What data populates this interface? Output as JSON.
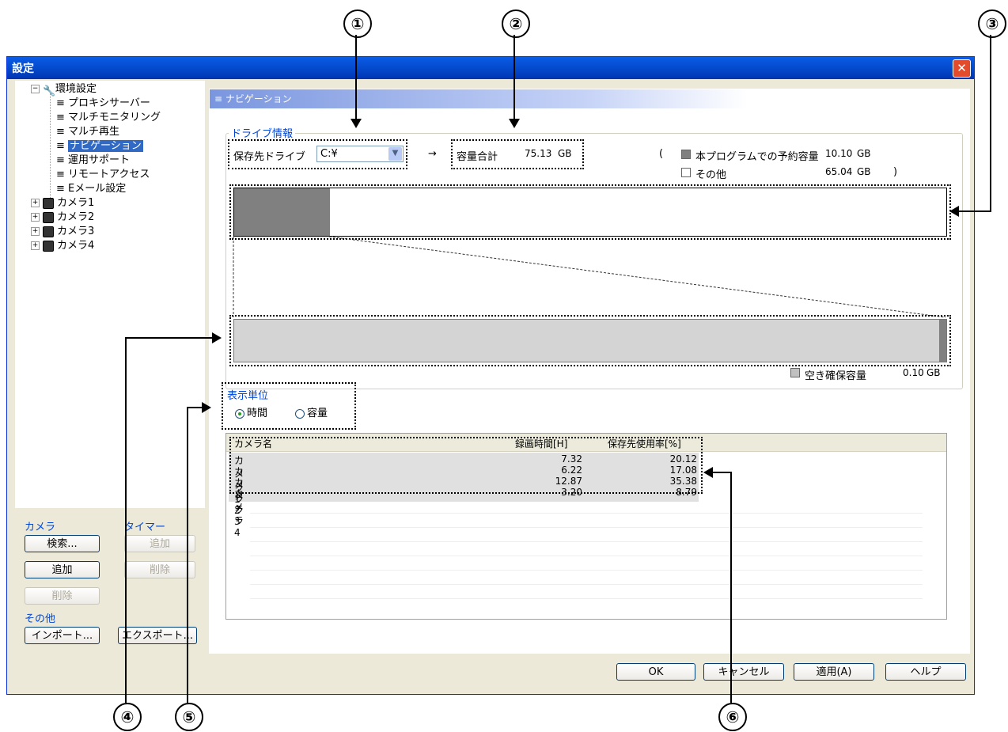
{
  "callouts": [
    "①",
    "②",
    "③",
    "④",
    "⑤",
    "⑥"
  ],
  "window": {
    "title": "設定",
    "close_glyph": "✕"
  },
  "tree": {
    "root": "環境設定",
    "children": [
      "プロキシサーバー",
      "マルチモニタリング",
      "マルチ再生",
      "ナビゲーション",
      "運用サポート",
      "リモートアクセス",
      "Eメール設定"
    ],
    "cameras": [
      "カメラ1",
      "カメラ2",
      "カメラ3",
      "カメラ4"
    ]
  },
  "left": {
    "camera_group": "カメラ",
    "timer_group": "タイマー",
    "search": "検索...",
    "add": "追加",
    "delete": "削除",
    "timer_add": "追加",
    "timer_delete": "削除",
    "other_group": "その他",
    "import": "インポート...",
    "export": "エクスポート..."
  },
  "nav": {
    "header": "ナビゲーション",
    "drive_group": "ドライブ情報",
    "drive_label": "保存先ドライブ",
    "drive_value": "C:¥",
    "arrow": "→",
    "capacity_label": "容量合計",
    "capacity_value": "75.13",
    "capacity_unit": "GB",
    "paren_open": "(",
    "paren_close": ")",
    "reserved_label": "本プログラムでの予約容量",
    "reserved_value": "10.10",
    "reserved_unit": "GB",
    "other_label": "その他",
    "other_value": "65.04",
    "other_unit": "GB",
    "free_label": "空き確保容量",
    "free_value": "0.10",
    "free_unit": "GB",
    "unit_group": "表示単位",
    "unit_time": "時間",
    "unit_capacity": "容量"
  },
  "usage": {
    "reserved_fraction": 0.134,
    "free_fraction_of_reserved": 0.01
  },
  "table": {
    "headers": [
      "カメラ名",
      "録画時間[H]",
      "保存先使用率[%]"
    ],
    "rows": [
      [
        "カメラ1",
        "7.32",
        "20.12"
      ],
      [
        "カメラ2",
        "6.22",
        "17.08"
      ],
      [
        "カメラ3",
        "12.87",
        "35.38"
      ],
      [
        "カメラ4",
        "3.20",
        "8.79"
      ]
    ]
  },
  "footer": {
    "ok": "OK",
    "cancel": "キャンセル",
    "apply": "適用(A)",
    "help": "ヘルプ"
  },
  "colors": {
    "titlebar": "#0347C8",
    "selection": "#316AC5",
    "group_label": "#0046D5",
    "reserved_bar": "#808080"
  }
}
